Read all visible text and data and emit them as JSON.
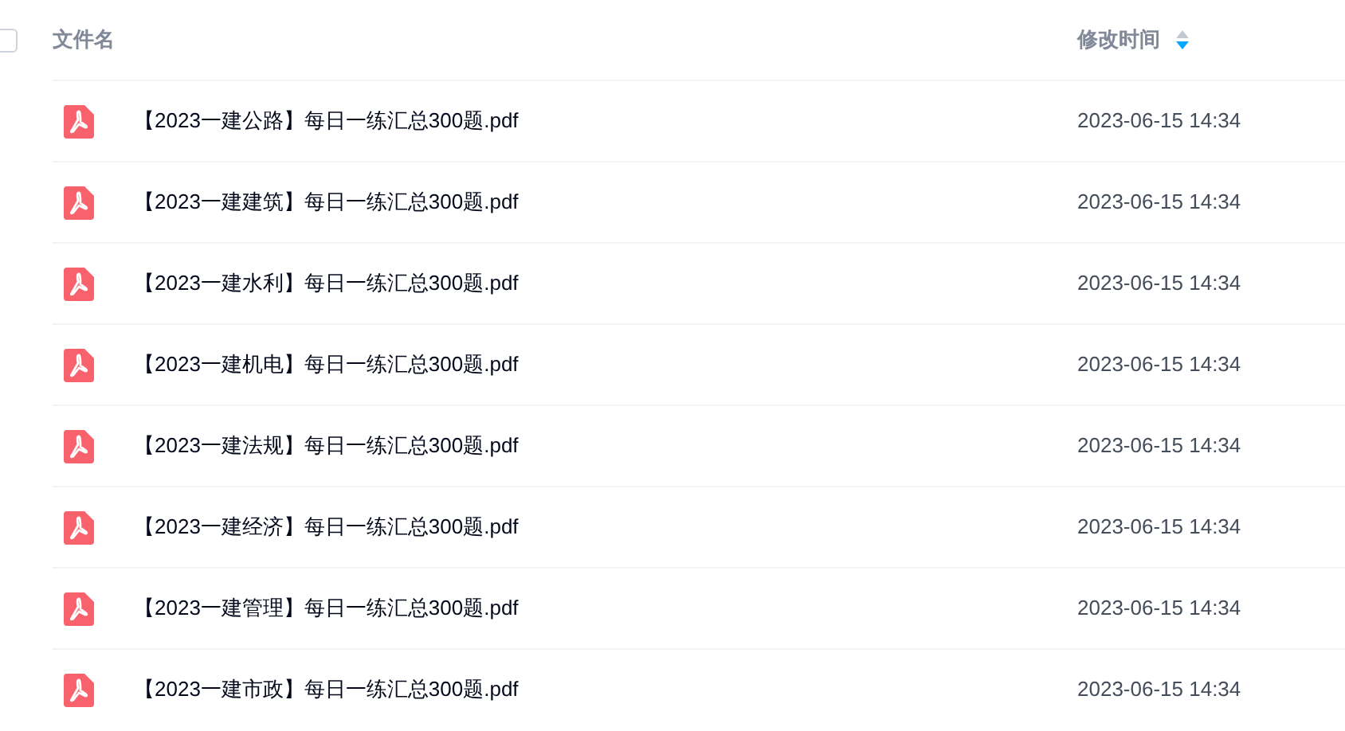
{
  "table": {
    "select_all": {
      "checked": false
    },
    "columns": [
      {
        "label": "文件名"
      },
      {
        "label": "修改时间",
        "sorted_descending": true
      }
    ],
    "rows": [
      {
        "name": "【2023一建公路】每日一练汇总300题.pdf",
        "modified": "2023-06-15 14:34"
      },
      {
        "name": "【2023一建建筑】每日一练汇总300题.pdf",
        "modified": "2023-06-15 14:34"
      },
      {
        "name": "【2023一建水利】每日一练汇总300题.pdf",
        "modified": "2023-06-15 14:34"
      },
      {
        "name": "【2023一建机电】每日一练汇总300题.pdf",
        "modified": "2023-06-15 14:34"
      },
      {
        "name": "【2023一建法规】每日一练汇总300题.pdf",
        "modified": "2023-06-15 14:34"
      },
      {
        "name": "【2023一建经济】每日一练汇总300题.pdf",
        "modified": "2023-06-15 14:34"
      },
      {
        "name": "【2023一建管理】每日一练汇总300题.pdf",
        "modified": "2023-06-15 14:34"
      },
      {
        "name": "【2023一建市政】每日一练汇总300题.pdf",
        "modified": "2023-06-15 14:34"
      }
    ]
  }
}
